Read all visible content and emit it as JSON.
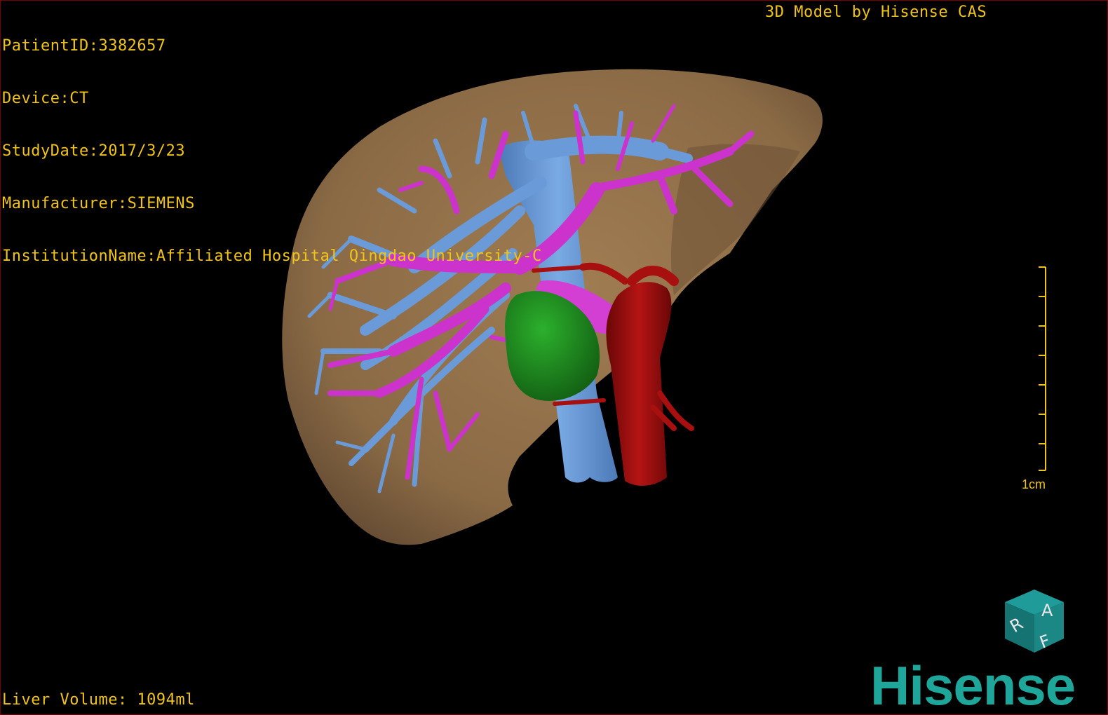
{
  "overlay": {
    "patient_id": "PatientID:3382657",
    "device": "Device:CT",
    "study_date": "StudyDate:2017/3/23",
    "manufacturer": "Manufacturer:SIEMENS",
    "institution": "InstitutionName:Affiliated Hospital Qingdao University-C",
    "credit": "3D Model by Hisense CAS",
    "liver_volume": "Liver Volume: 1094ml"
  },
  "scale": {
    "label": "1cm"
  },
  "orientation_cube": {
    "face_top": "A",
    "face_left": "R",
    "face_right": "F"
  },
  "brand": {
    "name": "Hisense"
  },
  "colors": {
    "overlay_text": "#f0c419",
    "liver": "#8a6a45",
    "portal_vein": "#6a9ad8",
    "hepatic_artery_branches": "#cc33cc",
    "aorta": "#9e0d0d",
    "lesion": "#1d8a1d",
    "brand": "#1fa69a"
  }
}
